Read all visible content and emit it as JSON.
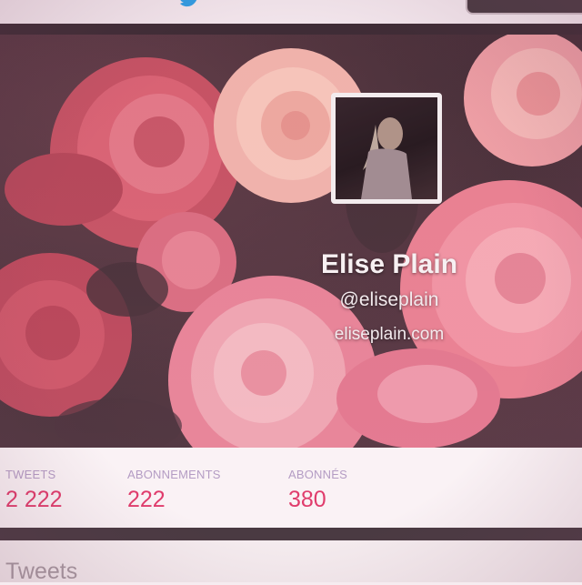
{
  "topbar": {
    "logo_icon": "bird-icon",
    "logo_color": "#2f9ee5"
  },
  "profile": {
    "name": "Elise Plain",
    "handle": "@eliseplain",
    "website": "eliseplain.com",
    "avatar_icon": "profile-photo"
  },
  "stats": [
    {
      "label": "TWEETS",
      "value": "2 222"
    },
    {
      "label": "ABONNEMENTS",
      "value": "222"
    },
    {
      "label": "ABONNÉS",
      "value": "380"
    }
  ],
  "tweets_section": {
    "heading": "Tweets"
  },
  "colors": {
    "accent": "#e03c6c",
    "stat_label": "#b49cc4",
    "header_background": "#3a242d"
  }
}
